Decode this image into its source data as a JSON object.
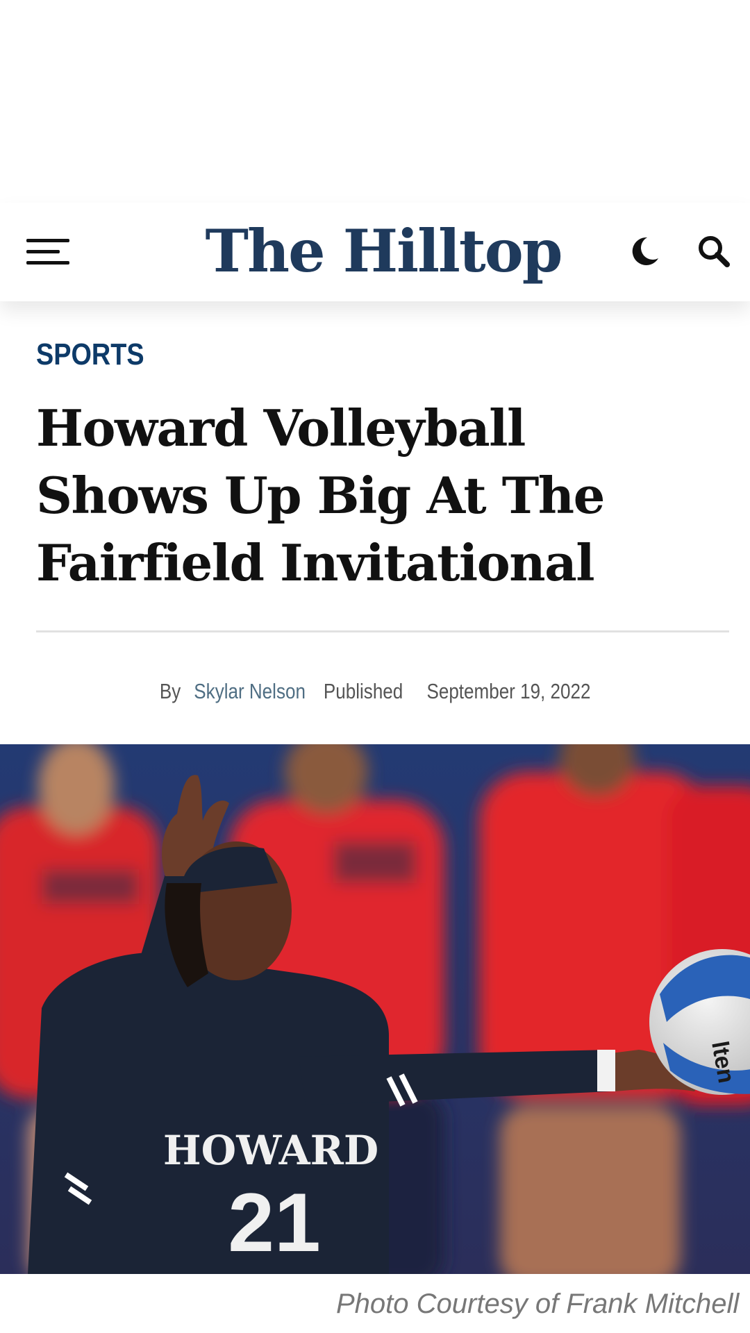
{
  "header": {
    "menu_icon": "hamburger-menu-icon",
    "logo_text": "The Hilltop",
    "theme_icon": "moon-icon",
    "search_icon": "search-icon",
    "brand_color": "#1f3a5c"
  },
  "article": {
    "category": "SPORTS",
    "category_color": "#0d3a68",
    "title": "Howard Volleyball Shows Up Big At The Fairfield Invitational",
    "byline": {
      "by_label": "By",
      "author": "Skylar Nelson",
      "published_label": "Published",
      "date": "September 19, 2022"
    },
    "image": {
      "jersey_text": "HOWARD",
      "jersey_number": "21",
      "ball_text": "lten"
    },
    "caption": "Photo Courtesy of Frank Mitchell"
  }
}
